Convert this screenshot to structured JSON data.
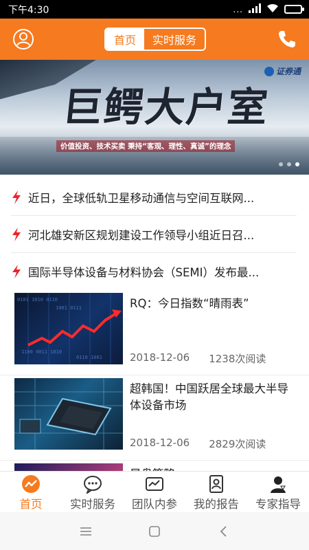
{
  "status_bar": {
    "time": "下午4:30",
    "overflow_dots": "...",
    "battery_level": 1.0
  },
  "header": {
    "tabs": [
      {
        "label": "首页",
        "active": true
      },
      {
        "label": "实时服务",
        "active": false
      }
    ],
    "icons": [
      "user-icon",
      "phone-icon"
    ]
  },
  "banner": {
    "headline": "巨鳄大户室",
    "slogan": "价值投资、技术买卖 秉持“客观、理性、真诚”的理念",
    "brand": "证券通",
    "slide_count": 3,
    "active_slide": 3
  },
  "news": [
    {
      "text": "近日，全球低轨卫星移动通信与空间互联网..."
    },
    {
      "text": "河北雄安新区规划建设工作领导小组近日召..."
    },
    {
      "text": "国际半导体设备与材料协会（SEMI）发布最..."
    }
  ],
  "articles": [
    {
      "title": "RQ：今日指数“晴雨表”",
      "date": "2018-12-06",
      "reads": "1238次阅读"
    },
    {
      "title": "超韩国！中国跃居全球最大半导体设备市场",
      "date": "2018-12-06",
      "reads": "2829次阅读"
    },
    {
      "title": "早盘策略",
      "date": "",
      "reads": ""
    }
  ],
  "bottom_nav": [
    {
      "label": "首页",
      "icon": "home-chart-icon",
      "active": true
    },
    {
      "label": "实时服务",
      "icon": "chat-bubble-icon",
      "active": false
    },
    {
      "label": "团队内参",
      "icon": "team-report-icon",
      "active": false
    },
    {
      "label": "我的报告",
      "icon": "my-report-icon",
      "active": false
    },
    {
      "label": "专家指导",
      "icon": "expert-icon",
      "active": false
    }
  ],
  "colors": {
    "accent": "#f67a1f",
    "bolt_red": "#e8262a",
    "text": "#222222",
    "meta": "#666666"
  }
}
